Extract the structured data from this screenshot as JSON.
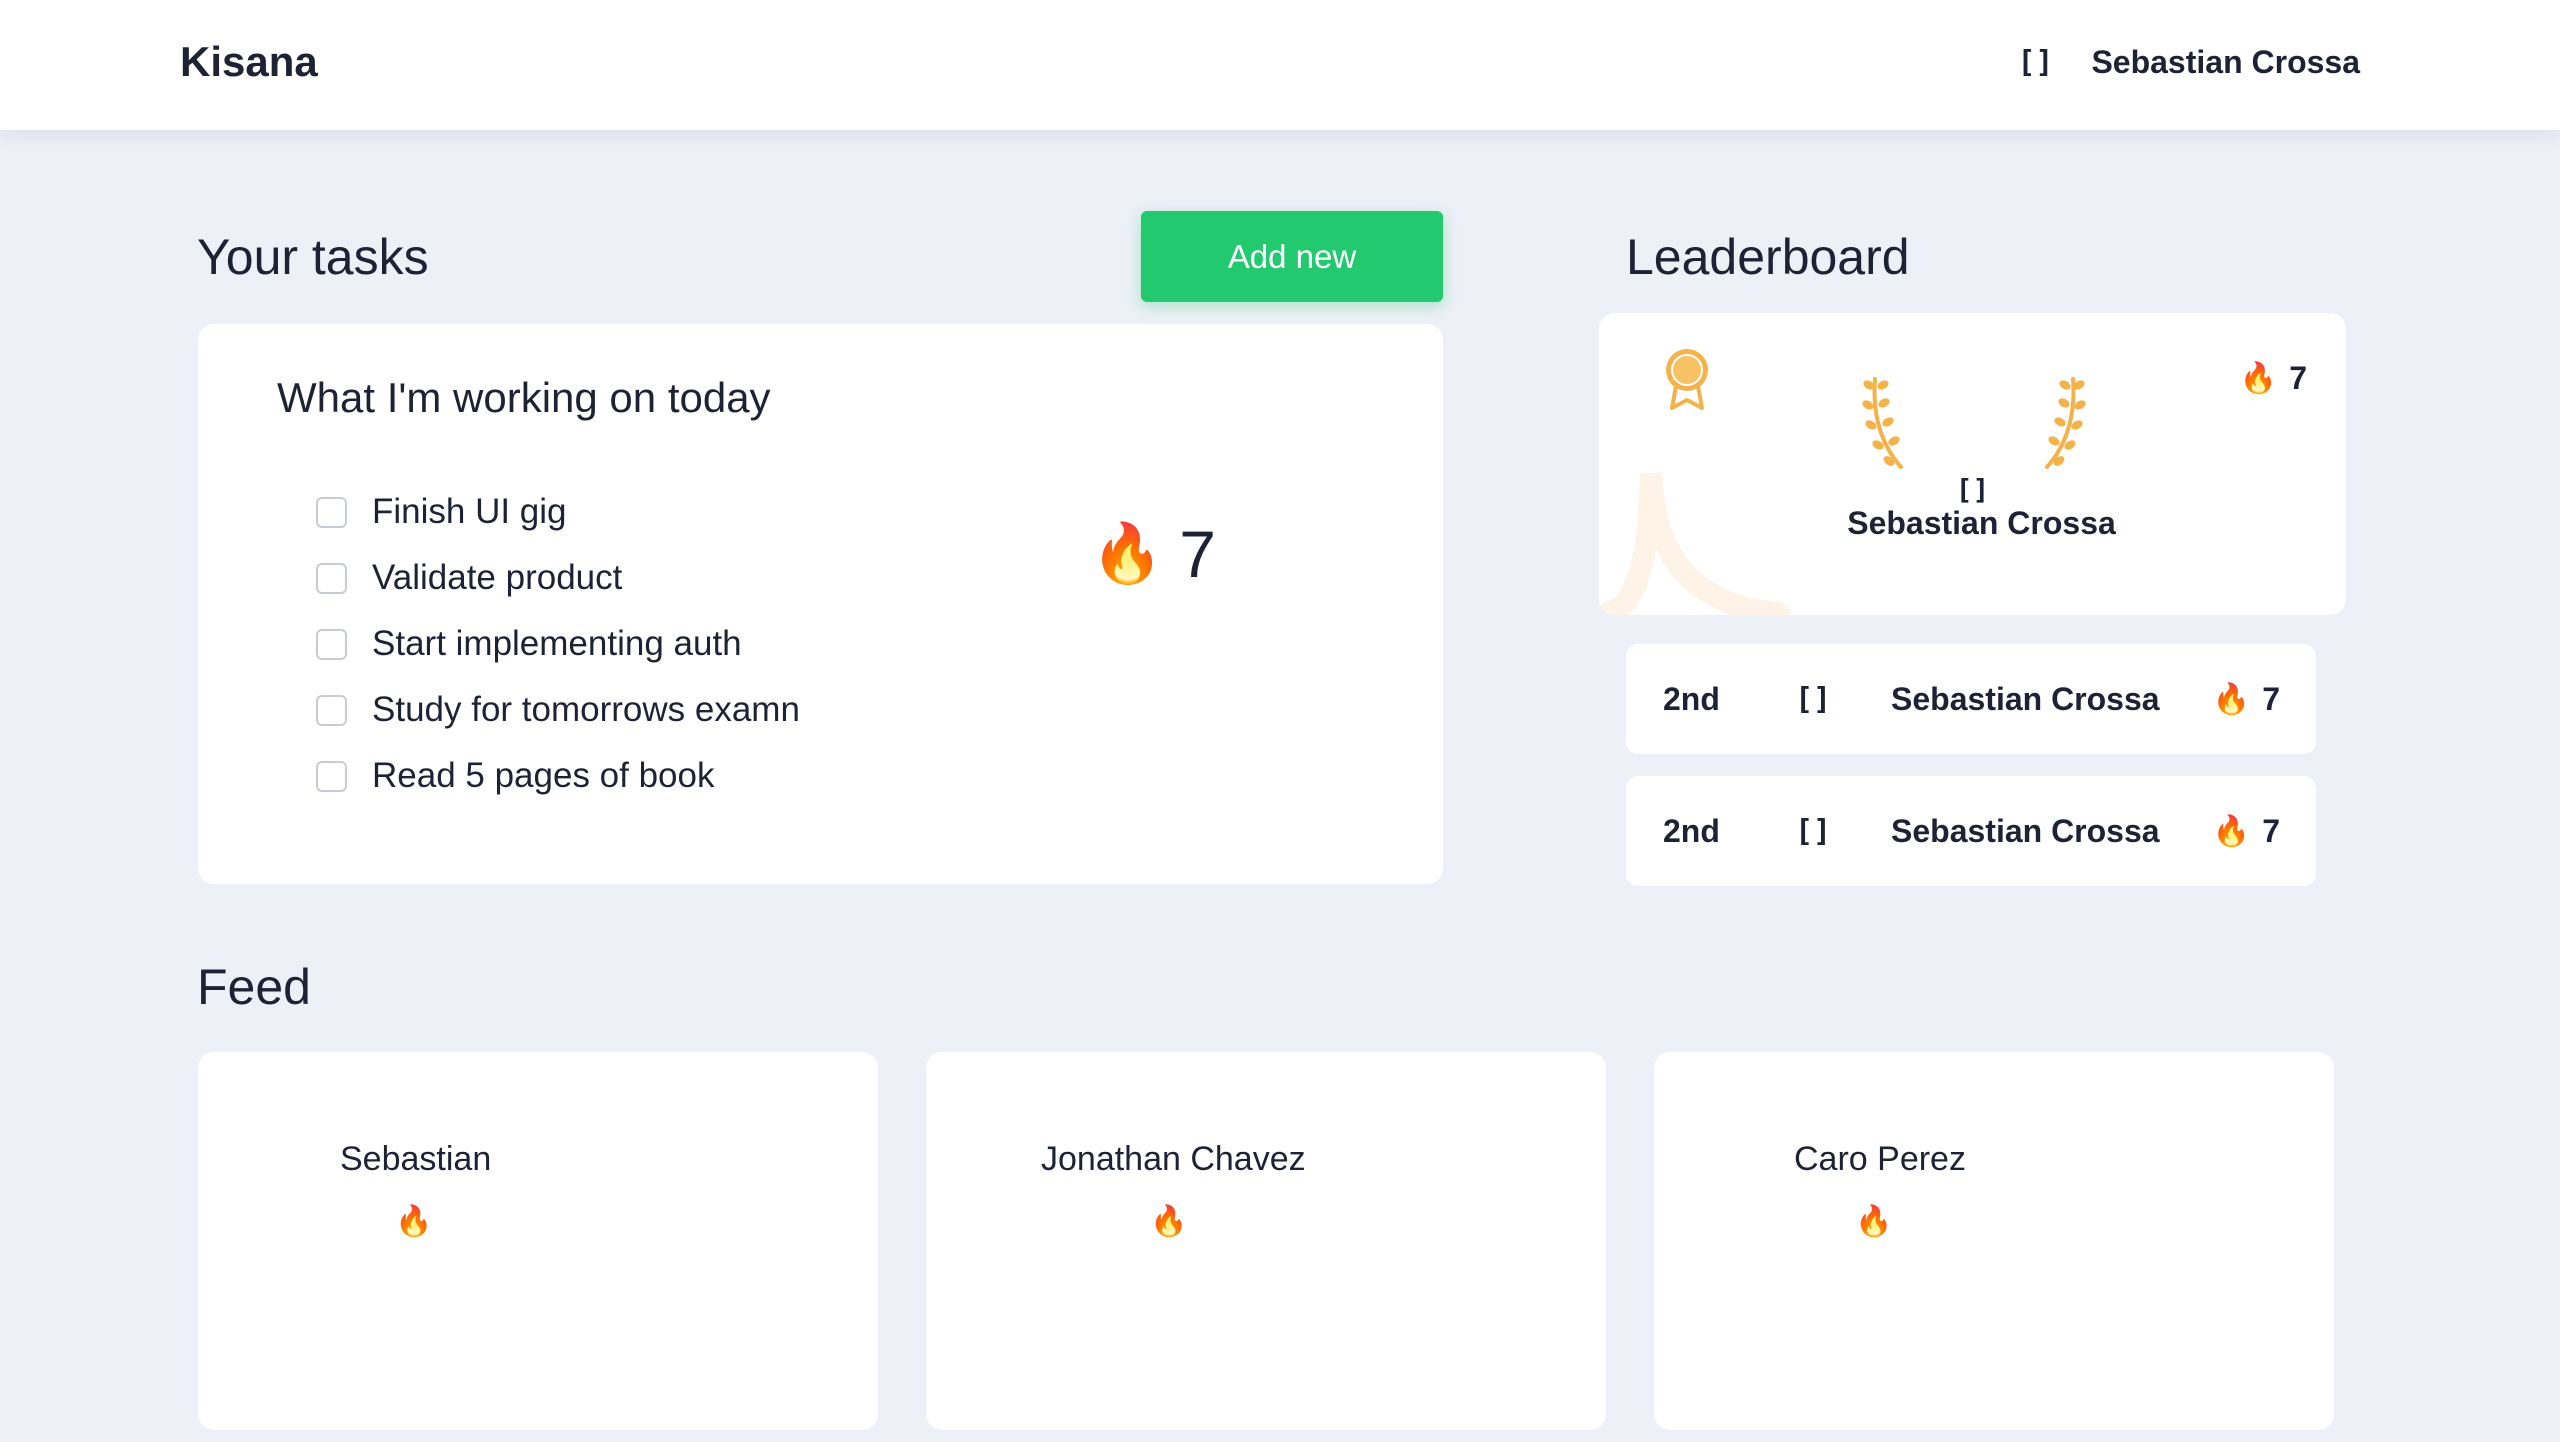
{
  "header": {
    "brand": "Kisana",
    "avatar_placeholder": "[]",
    "user_name": "Sebastian Crossa"
  },
  "tasks_section": {
    "title": "Your tasks",
    "add_button_label": "Add new",
    "card_heading": "What I'm working on today",
    "items": [
      {
        "label": "Finish UI gig",
        "checked": false
      },
      {
        "label": "Validate product",
        "checked": false
      },
      {
        "label": "Start implementing auth",
        "checked": false
      },
      {
        "label": "Study for tomorrows examn",
        "checked": false
      },
      {
        "label": "Read 5 pages of book",
        "checked": false
      }
    ],
    "streak_icon": "fire-emoji",
    "streak_emoji": "🔥",
    "streak_count": "7"
  },
  "leaderboard": {
    "title": "Leaderboard",
    "top": {
      "avatar_placeholder": "[]",
      "name": "Sebastian Crossa",
      "streak_emoji": "🔥",
      "streak_count": "7",
      "icons": [
        "medal-icon",
        "laurel-left-icon",
        "laurel-right-icon"
      ]
    },
    "rows": [
      {
        "position": "2nd",
        "avatar_placeholder": "[]",
        "name": "Sebastian Crossa",
        "streak_emoji": "🔥",
        "streak_count": "7"
      },
      {
        "position": "2nd",
        "avatar_placeholder": "[]",
        "name": "Sebastian Crossa",
        "streak_emoji": "🔥",
        "streak_count": "7"
      }
    ]
  },
  "feed": {
    "title": "Feed",
    "cards": [
      {
        "name": "Sebastian",
        "flame_emoji": "🔥"
      },
      {
        "name": "Jonathan Chavez",
        "flame_emoji": "🔥"
      },
      {
        "name": "Caro Perez",
        "flame_emoji": "🔥"
      }
    ]
  },
  "colors": {
    "background": "#edf0f7",
    "accent_green": "#22c96f",
    "text_dark": "#1e2235",
    "gold": "#f4b24a"
  }
}
